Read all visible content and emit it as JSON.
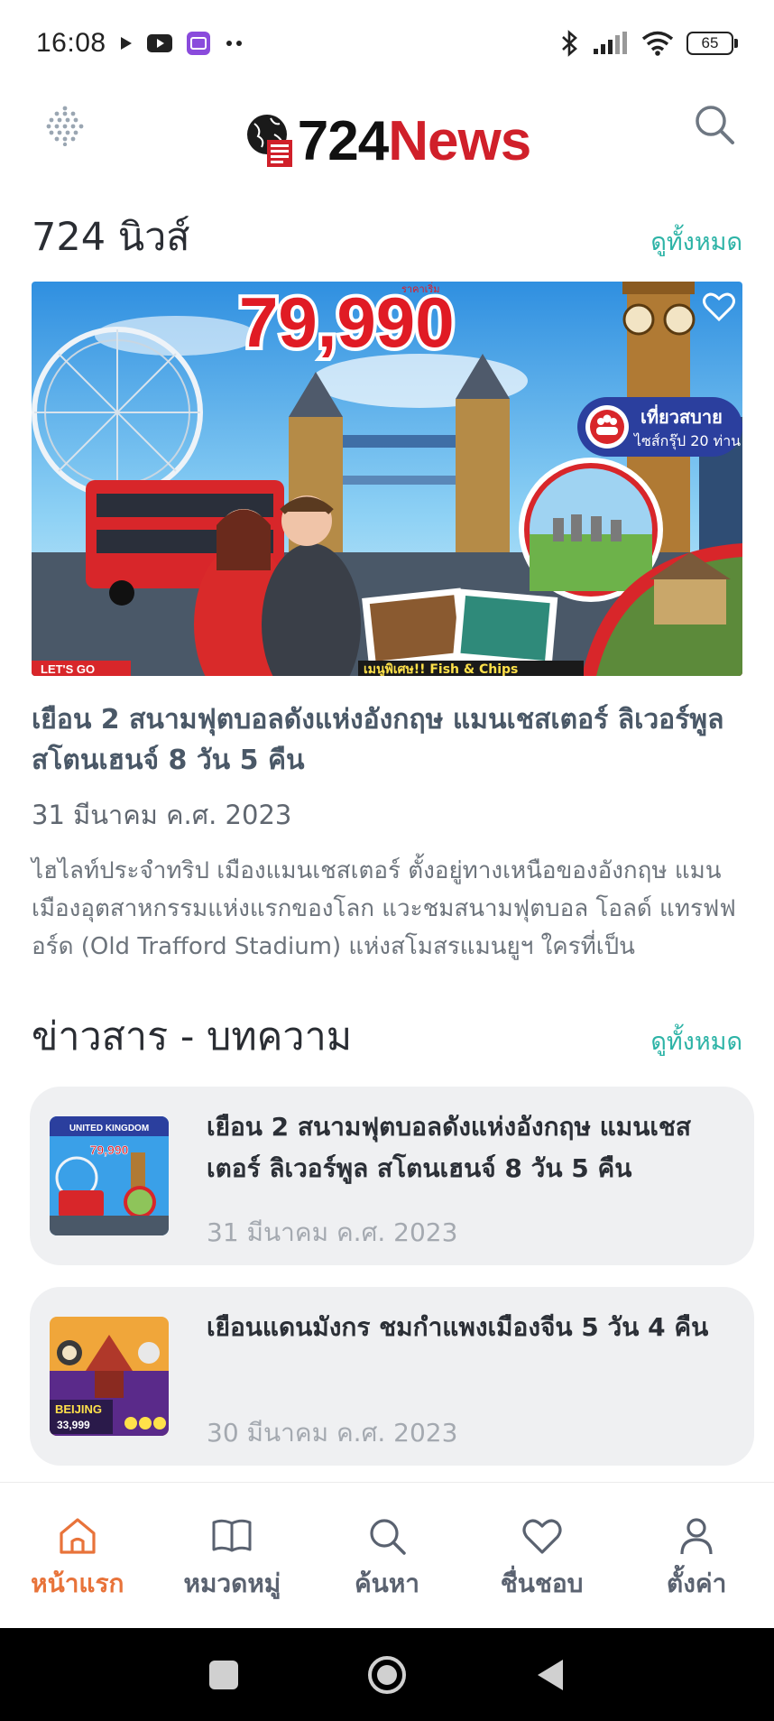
{
  "status_bar": {
    "time": "16:08",
    "battery": "65",
    "left_icons": [
      "play-icon",
      "youtube-icon",
      "app-icon",
      "more-dots-icon"
    ],
    "right_icons": [
      "bluetooth-icon",
      "signal-icon",
      "wifi-icon",
      "battery-icon"
    ]
  },
  "header": {
    "logo_number": "724",
    "logo_word": "News",
    "menu_icon": "grid-dots-icon",
    "search_icon": "search-icon"
  },
  "section_news": {
    "title": "724 นิวส์",
    "see_all": "ดูทั้งหมด"
  },
  "featured": {
    "banner_price": "79,990",
    "banner_price_caption": "ราคาเริ่ม",
    "banner_badge_line1": "เที่ยวสบาย",
    "banner_badge_line2": "ไซส์กรุ๊ป 20 ท่าน",
    "banner_footer": "เมนูพิเศษ!! Fish & Chips",
    "banner_corner": "LET'S GO",
    "title": "เยือน 2 สนามฟุตบอลดังแห่งอังกฤษ แมนเชสเตอร์ ลิเวอร์พูล สโตนเฮนจ์ 8 วัน 5 คืน",
    "date": "31 มีนาคม ค.ศ. 2023",
    "excerpt": "ไฮไลท์ประจำทริป เมืองแมนเชสเตอร์ ตั้งอยู่ทางเหนือของอังกฤษ แมนเมืองอุตสาหกรรมแห่งแรกของโลก แวะชมสนามฟุตบอล โอลด์ แทรฟฟอร์ด (Old Trafford Stadium) แห่งสโมสรแมนยูฯ ใครที่เป็น"
  },
  "section_articles": {
    "title": "ข่าวสาร - บทความ",
    "see_all": "ดูทั้งหมด"
  },
  "articles": [
    {
      "thumb_label": "UNITED KINGDOM",
      "thumb_price": "79,990",
      "title": "เยือน 2 สนามฟุตบอลดังแห่งอังกฤษ แมนเชสเตอร์ ลิเวอร์พูล สโตนเฮนจ์ 8 วัน 5 คืน",
      "date": "31 มีนาคม ค.ศ. 2023"
    },
    {
      "thumb_label": "BEIJING",
      "thumb_price": "33,999",
      "title": "เยือนแดนมังกร ชมกำแพงเมืองจีน 5 วัน 4 คืน",
      "date": "30 มีนาคม ค.ศ. 2023"
    }
  ],
  "bottom_nav": [
    {
      "label": "หน้าแรก",
      "icon": "home-icon",
      "active": true
    },
    {
      "label": "หมวดหมู่",
      "icon": "book-icon",
      "active": false
    },
    {
      "label": "ค้นหา",
      "icon": "search-icon",
      "active": false
    },
    {
      "label": "ชื่นชอบ",
      "icon": "heart-icon",
      "active": false
    },
    {
      "label": "ตั้งค่า",
      "icon": "user-icon",
      "active": false
    }
  ],
  "colors": {
    "accent": "#2cb3a6",
    "active_nav": "#e8733a",
    "brand_red": "#d0202a",
    "card_bg": "#eff0f2"
  }
}
